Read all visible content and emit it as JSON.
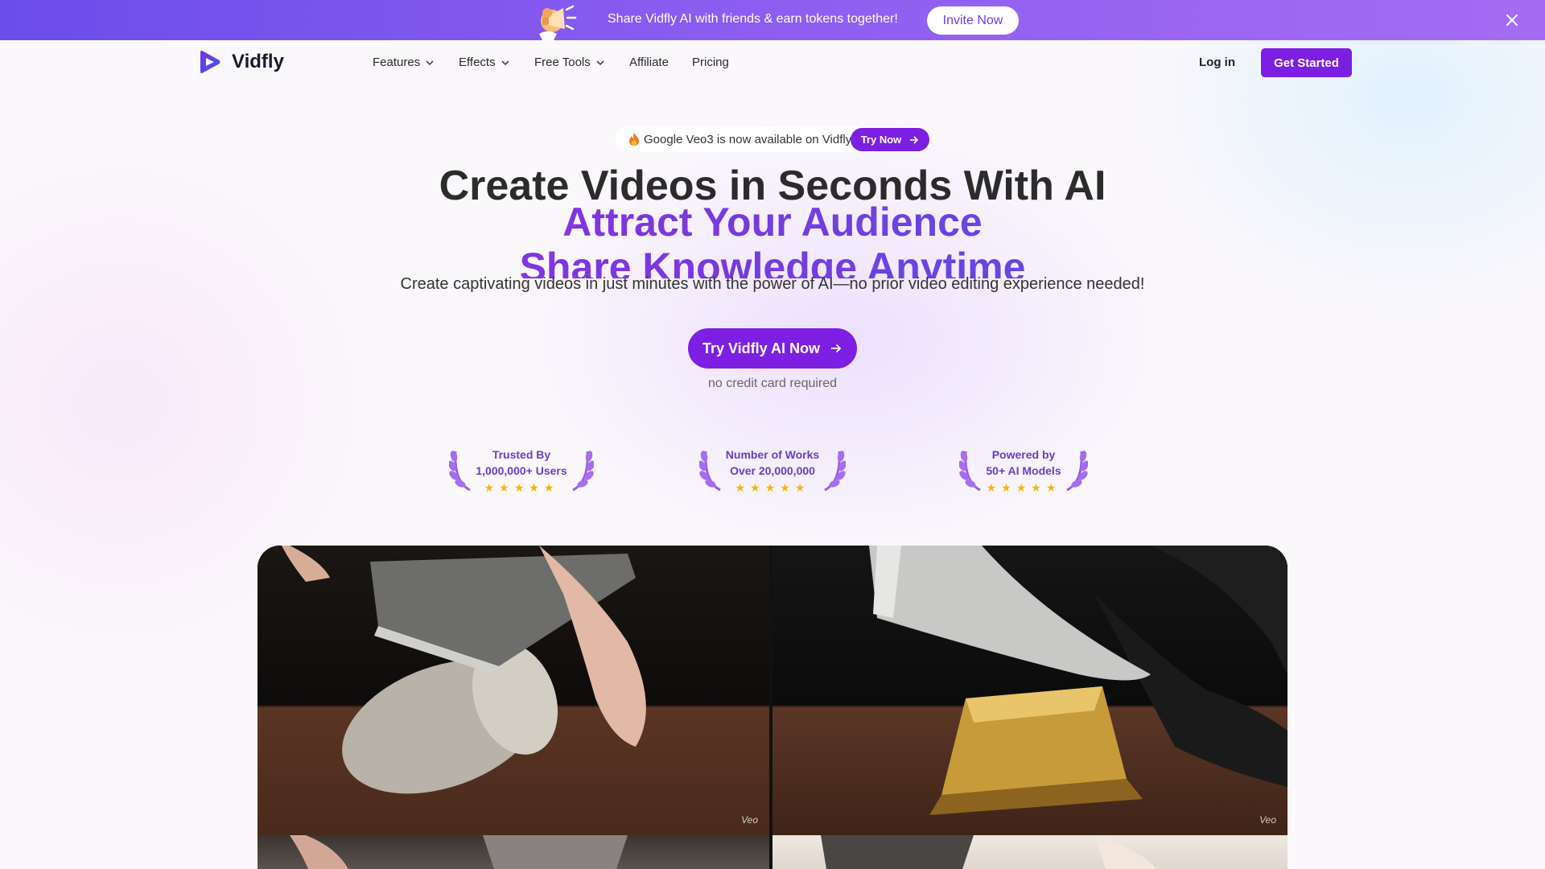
{
  "promo": {
    "text": "Share Vidfly AI with friends & earn tokens together!",
    "invite_label": "Invite Now",
    "close_icon": "close-icon"
  },
  "nav": {
    "brand": "Vidfly",
    "items": [
      {
        "label": "Features",
        "dropdown": true
      },
      {
        "label": "Effects",
        "dropdown": true
      },
      {
        "label": "Free Tools",
        "dropdown": true
      },
      {
        "label": "Affiliate",
        "dropdown": false
      },
      {
        "label": "Pricing",
        "dropdown": false
      }
    ],
    "login_label": "Log in",
    "get_started_label": "Get Started"
  },
  "announcement": {
    "text": "Google Veo3 is now available on Vidfly",
    "button_label": "Try Now"
  },
  "hero": {
    "title": "Create Videos in Seconds With AI",
    "rotating": [
      "Attract Your Audience",
      "Share Knowledge Anytime"
    ],
    "subtitle": "Create captivating videos in just minutes with the power of AI—no prior video editing experience needed!",
    "cta_label": "Try Vidfly AI Now",
    "note": "no credit card required"
  },
  "badges": [
    {
      "line1": "Trusted By",
      "line2": "1,000,000+ Users",
      "stars": "★★★★★"
    },
    {
      "line1": "Number of Works",
      "line2": "Over 20,000,000",
      "stars": "★★★★★"
    },
    {
      "line1": "Powered by",
      "line2": "50+ AI Models",
      "stars": "★★★★★"
    }
  ],
  "gallery": {
    "watermark": "Veo"
  },
  "colors": {
    "accent": "#7c1fe3",
    "promo_start": "#6b4dea",
    "promo_end": "#a56cf3",
    "badge_text": "#6a3dc8",
    "star": "#f5b800"
  }
}
